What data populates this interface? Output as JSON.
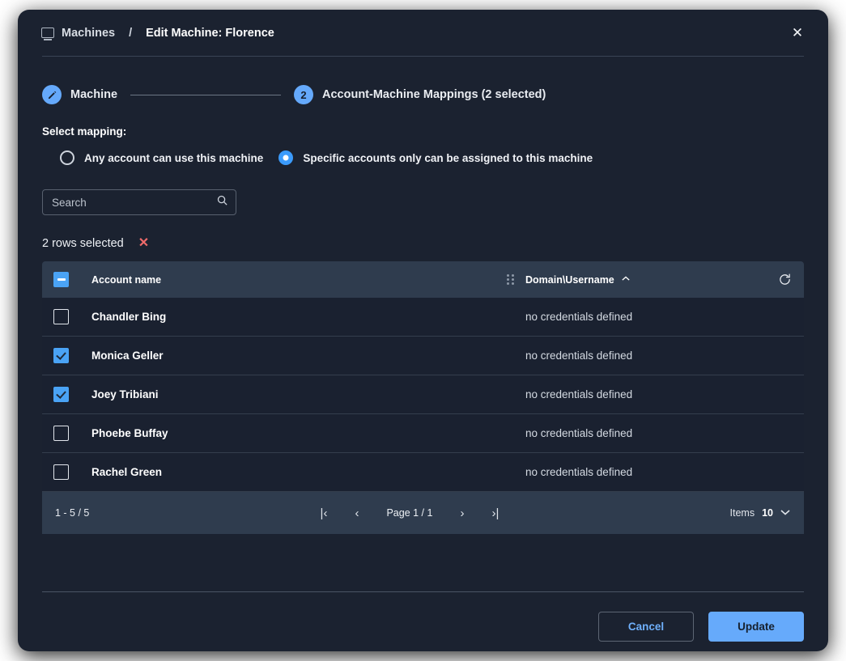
{
  "header": {
    "breadcrumb_root": "Machines",
    "breadcrumb_separator": "/",
    "breadcrumb_current": "Edit Machine: Florence",
    "close_label": "✕",
    "monitor_icon": "monitor-icon",
    "close_icon": "close-icon"
  },
  "stepper": {
    "step1_label": "Machine",
    "step1_icon": "pencil-icon",
    "step2_number": "2",
    "step2_label": "Account-Machine Mappings (2 selected)"
  },
  "mapping": {
    "section_label": "Select mapping:",
    "options": [
      {
        "label": "Any account can use this machine",
        "selected": false
      },
      {
        "label": "Specific accounts only can be assigned to this machine",
        "selected": true
      }
    ]
  },
  "search": {
    "placeholder": "Search",
    "value": "",
    "icon": "search-icon"
  },
  "selection": {
    "text": "2 rows selected",
    "clear_label": "✕",
    "clear_color": "#ef6b6b"
  },
  "table": {
    "columns": {
      "account_name": "Account name",
      "domain_username": "Domain\\Username",
      "sort_caret": "⌃"
    },
    "header_checkbox_state": "indeterminate",
    "refresh_icon": "refresh-icon",
    "grip_icon": "drag-handle-icon",
    "rows": [
      {
        "name": "Chandler Bing",
        "domain": "no credentials defined",
        "checked": false
      },
      {
        "name": "Monica Geller",
        "domain": "no credentials defined",
        "checked": true
      },
      {
        "name": "Joey Tribiani",
        "domain": "no credentials defined",
        "checked": true
      },
      {
        "name": "Phoebe Buffay",
        "domain": "no credentials defined",
        "checked": false
      },
      {
        "name": "Rachel Green",
        "domain": "no credentials defined",
        "checked": false
      }
    ]
  },
  "pagination": {
    "range": "1 - 5 / 5",
    "first_label": "|‹",
    "prev_label": "‹",
    "page_label": "Page 1 / 1",
    "next_label": "›",
    "last_label": "›|",
    "items_label": "Items",
    "items_value": "10",
    "items_caret": "⌄"
  },
  "footer": {
    "cancel_label": "Cancel",
    "update_label": "Update"
  },
  "colors": {
    "accent": "#66aafb",
    "modal_bg": "#1b2230",
    "table_header_bg": "#2f3c4e",
    "row_bg": "#1a2130",
    "danger": "#ef6b6b",
    "page_bg": "#ffffff"
  }
}
